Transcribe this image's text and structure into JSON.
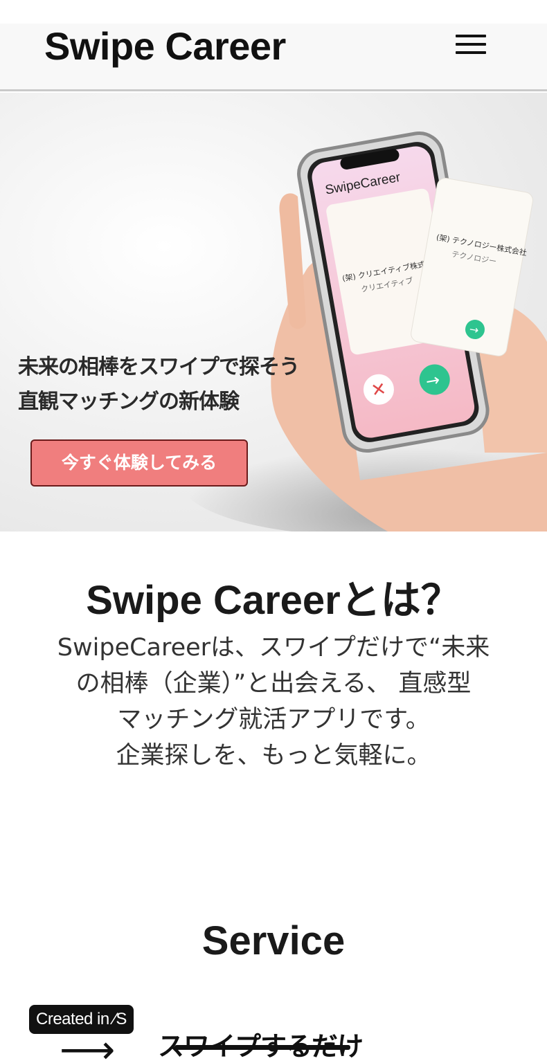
{
  "header": {
    "logo": "Swipe Career"
  },
  "hero": {
    "headline_line1": "未来の相棒をスワイプで探そう",
    "headline_line2": "直観マッチングの新体験",
    "cta_label": "今すぐ体験してみる",
    "phone": {
      "app_name": "SwipeCareer",
      "card_back_company": "(架) クリエイティブ株式",
      "card_back_sub": "クリエイティブ",
      "card_front_company": "(架) テクノロジー株式会社",
      "card_front_sub": "テクノロジー"
    }
  },
  "about": {
    "title": "Swipe Careerとは？",
    "lines": [
      "SwipeCareerは、スワイプだけで“未来",
      "の相棒（企業）”と出会える、 直感型",
      "マッチング就活アプリです。",
      "企業探しを、もっと気軽に。"
    ]
  },
  "service": {
    "title": "Service",
    "step_text": "スワイプするだけ",
    "arrow": "⟶"
  },
  "badge": {
    "label": "Created in ∕S"
  },
  "colors": {
    "cta": "#f07e7e",
    "accept": "#2ec48f",
    "reject": "#e04848"
  }
}
